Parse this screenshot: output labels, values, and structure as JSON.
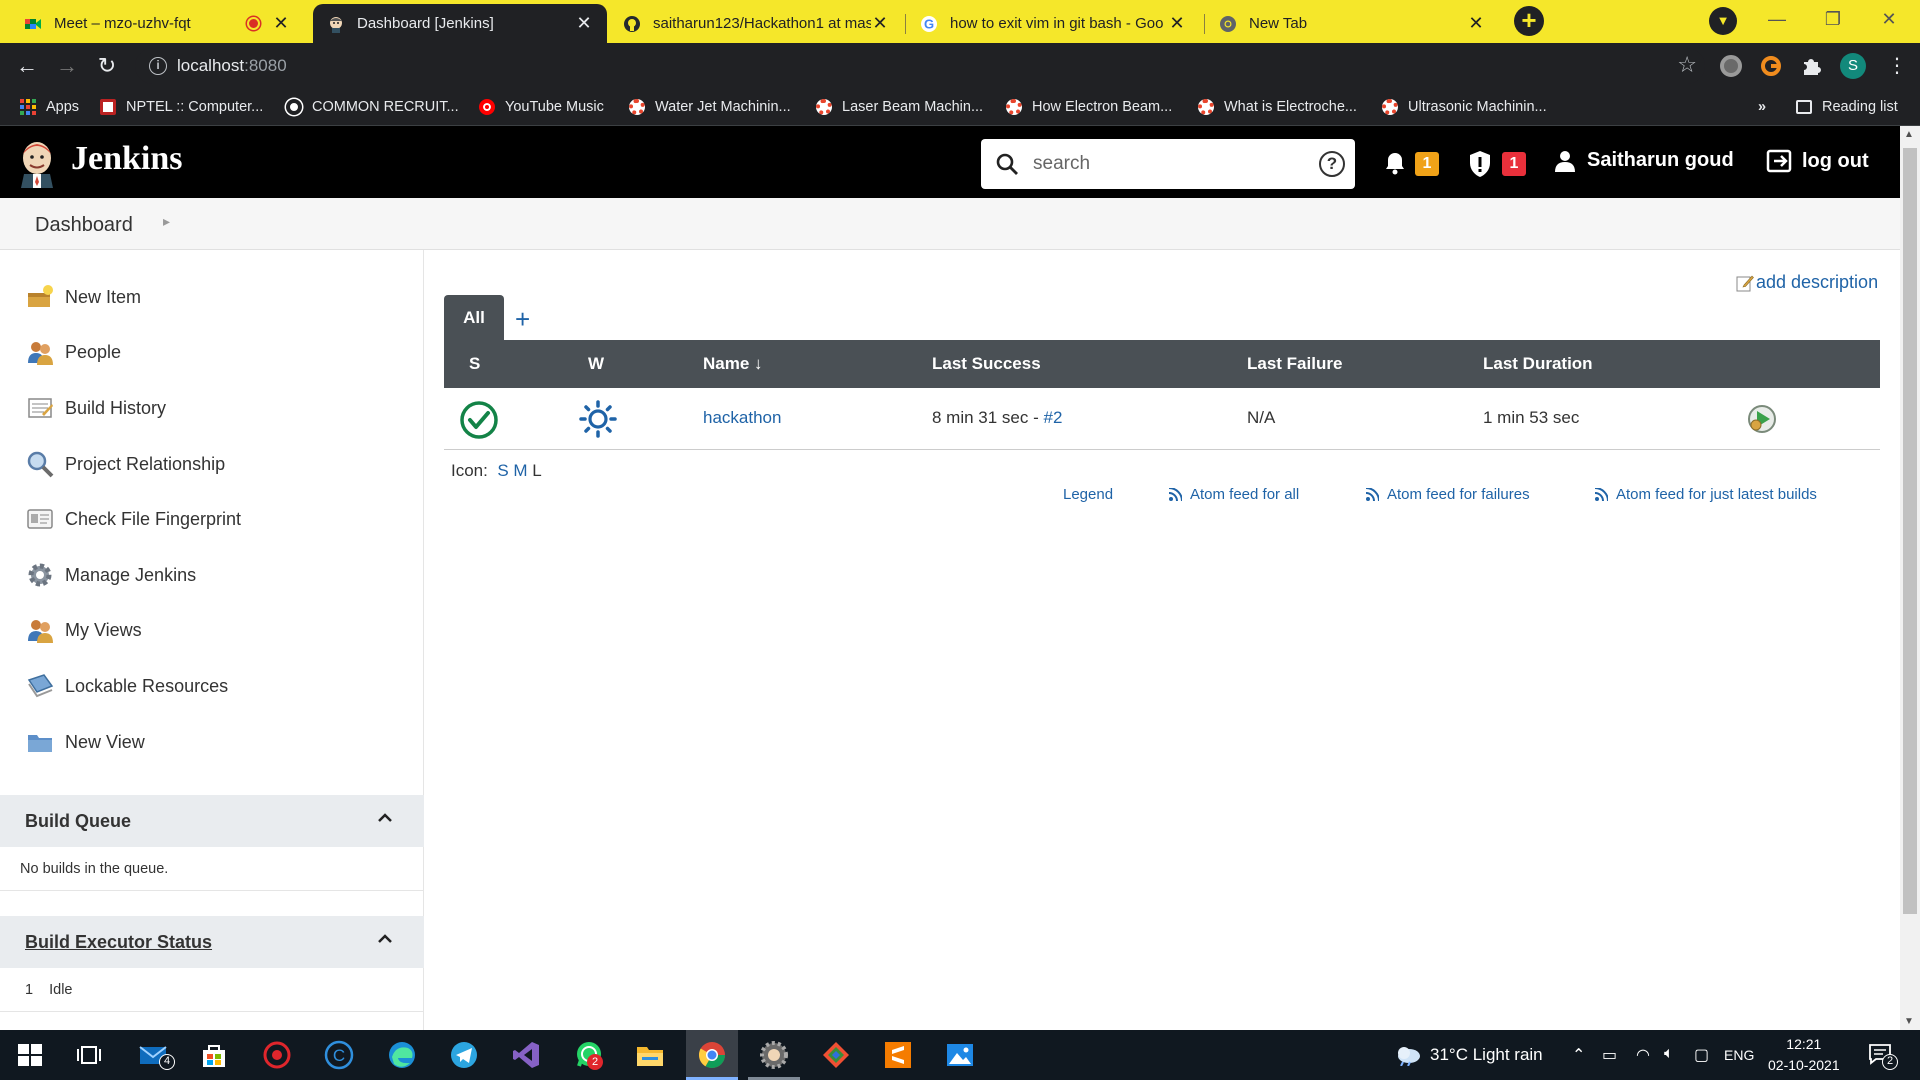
{
  "browser": {
    "tabs": [
      {
        "title": "Meet – mzo-uzhv-fqt",
        "icon": "google-meet-icon",
        "recording": true
      },
      {
        "title": "Dashboard [Jenkins]",
        "icon": "jenkins-icon",
        "active": true
      },
      {
        "title": "saitharun123/Hackathon1 at mas",
        "icon": "github-icon"
      },
      {
        "title": "how to exit vim in git bash - Goo",
        "icon": "google-icon"
      },
      {
        "title": "New Tab",
        "icon": "chrome-icon"
      }
    ],
    "url_host": "localhost",
    "url_port": ":8080",
    "profile_initial": "S",
    "bookmarks": [
      {
        "label": "Apps",
        "icon": "apps-grid-icon"
      },
      {
        "label": "NPTEL :: Computer...",
        "icon": "nptel-icon"
      },
      {
        "label": "COMMON RECRUIT...",
        "icon": "globe-icon"
      },
      {
        "label": "YouTube Music",
        "icon": "youtube-music-icon"
      },
      {
        "label": "Water Jet Machinin...",
        "icon": "site-icon"
      },
      {
        "label": "Laser Beam Machin...",
        "icon": "site-icon"
      },
      {
        "label": "How Electron Beam...",
        "icon": "site-icon"
      },
      {
        "label": "What is Electroche...",
        "icon": "site-icon"
      },
      {
        "label": "Ultrasonic Machinin...",
        "icon": "site-icon"
      }
    ],
    "more_bookmarks": "»",
    "reading_list": "Reading list"
  },
  "header": {
    "brand": "Jenkins",
    "search_placeholder": "search",
    "notifications_count": "1",
    "security_count": "1",
    "user_name": "Saitharun goud",
    "logout_label": "log out"
  },
  "breadcrumb": {
    "items": [
      "Dashboard"
    ]
  },
  "sidebar": {
    "tasks": [
      {
        "label": "New Item",
        "icon": "new-item-icon"
      },
      {
        "label": "People",
        "icon": "people-icon"
      },
      {
        "label": "Build History",
        "icon": "build-history-icon"
      },
      {
        "label": "Project Relationship",
        "icon": "search-icon"
      },
      {
        "label": "Check File Fingerprint",
        "icon": "fingerprint-icon"
      },
      {
        "label": "Manage Jenkins",
        "icon": "gear-icon"
      },
      {
        "label": "My Views",
        "icon": "people-icon"
      },
      {
        "label": "Lockable Resources",
        "icon": "lock-resource-icon"
      },
      {
        "label": "New View",
        "icon": "folder-icon"
      }
    ],
    "build_queue": {
      "title": "Build Queue",
      "empty_text": "No builds in the queue."
    },
    "executor_status": {
      "title": "Build Executor Status",
      "executor_number": "1",
      "executor_state": "Idle"
    }
  },
  "main": {
    "add_description": "add description",
    "view_tab": "All",
    "add_view_symbol": "+",
    "columns": [
      "S",
      "W",
      "Name ↓",
      "Last Success",
      "Last Failure",
      "Last Duration"
    ],
    "jobs": [
      {
        "status": "success",
        "weather": "sunny",
        "name": "hackathon",
        "last_success": "8 min 31 sec - ",
        "last_success_build": "#2",
        "last_failure": "N/A",
        "last_duration": "1 min 53 sec"
      }
    ],
    "icon_label": "Icon:",
    "icon_sizes": [
      "S",
      "M",
      "L"
    ],
    "legend": "Legend",
    "feeds": [
      "Atom feed for all",
      "Atom feed for failures",
      "Atom feed for just latest builds"
    ]
  },
  "taskbar": {
    "mail_badge": "4",
    "whatsapp_badge": "2",
    "weather": "31°C  Light rain",
    "language": "ENG",
    "time": "12:21",
    "date": "02-10-2021",
    "notifications_badge": "2"
  },
  "colors": {
    "tab_strip": "#f5e72a",
    "jenkins_header": "#000000",
    "badge_warning": "#f0a218",
    "badge_danger": "#e9303b",
    "link": "#1f63a7",
    "table_header": "#4a5055",
    "success": "#138347"
  }
}
